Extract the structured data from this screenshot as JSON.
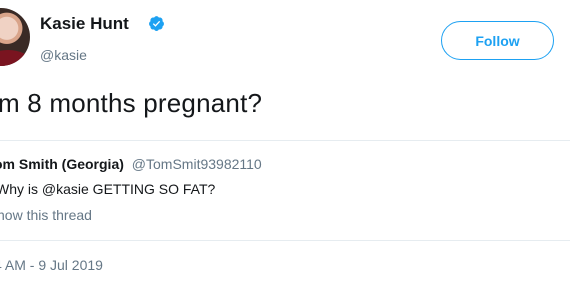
{
  "author": {
    "display_name": "Kasie Hunt",
    "handle": "@kasie",
    "verified": true
  },
  "follow_button": {
    "label": "Follow"
  },
  "tweet": {
    "text": "m 8 months pregnant?"
  },
  "quoted_tweet": {
    "author_name": "om Smith (Georgia)",
    "author_handle": "@TomSmit93982110",
    "text": "Why is @kasie GETTING SO FAT?",
    "show_thread": "how this thread"
  },
  "timestamp": "4 AM - 9 Jul 2019",
  "colors": {
    "accent": "#1da1f2",
    "text_primary": "#14171a",
    "text_secondary": "#657786",
    "divider": "#e6ecf0"
  },
  "icons": {
    "verified": "verified-badge-icon"
  }
}
